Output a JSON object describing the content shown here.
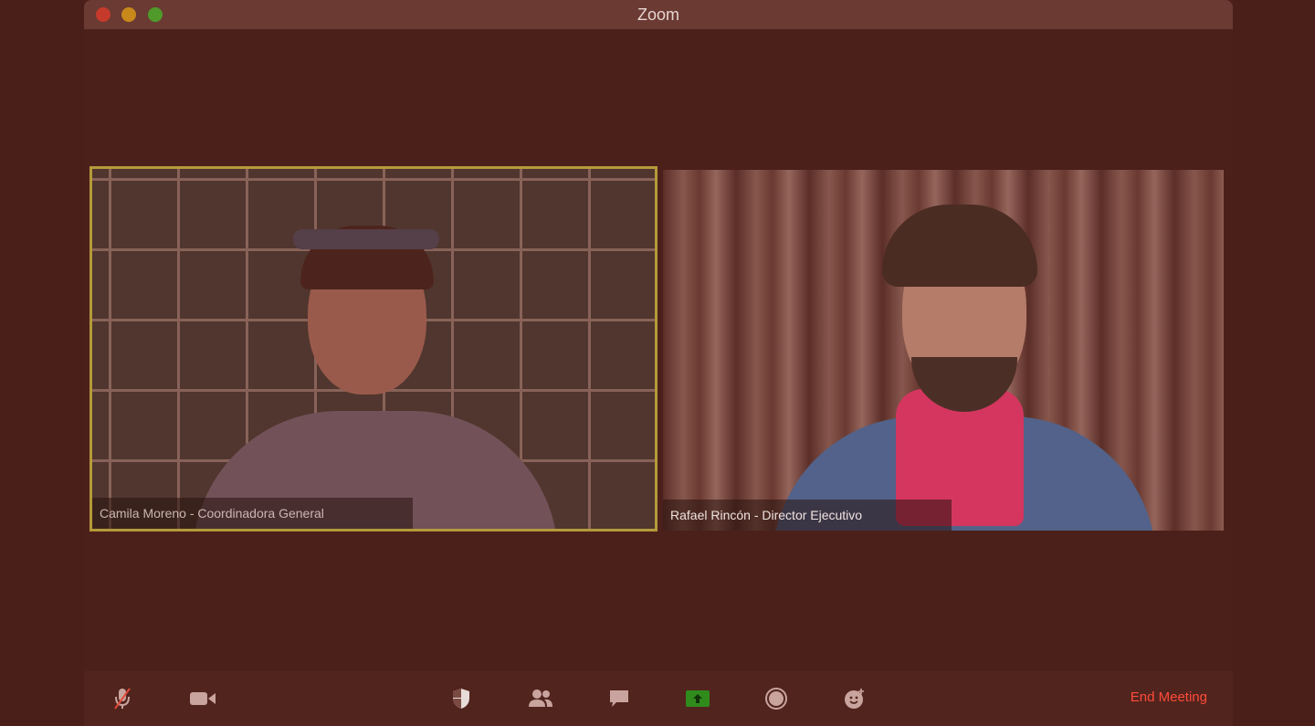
{
  "window": {
    "title": "Zoom"
  },
  "participants": [
    {
      "name_label": "Camila Moreno - Coordinadora General",
      "active_speaker": true
    },
    {
      "name_label": "Rafael Rincón - Director Ejecutivo",
      "active_speaker": false
    }
  ],
  "toolbar": {
    "items": [
      {
        "icon": "microphone-muted-icon"
      },
      {
        "icon": "video-camera-icon"
      },
      {
        "icon": "security-shield-icon"
      },
      {
        "icon": "participants-icon"
      },
      {
        "icon": "chat-icon"
      },
      {
        "icon": "share-screen-icon"
      },
      {
        "icon": "record-icon"
      },
      {
        "icon": "reactions-icon"
      }
    ],
    "end_meeting_label": "End Meeting"
  },
  "colors": {
    "background": "#4a1f19",
    "titlebar": "#6a3a33",
    "active_speaker_border": "#b49a3a",
    "end_meeting": "#ff4b3a",
    "share_green": "#2f8b1c"
  }
}
